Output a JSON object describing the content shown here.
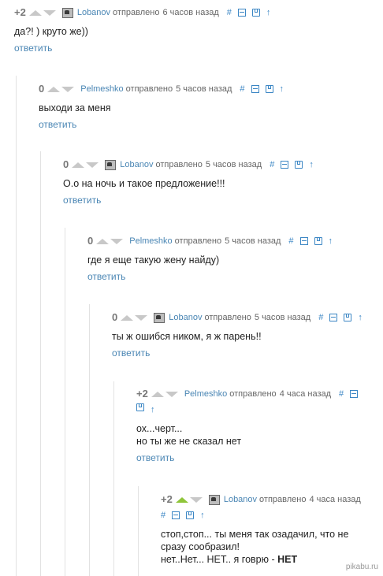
{
  "common": {
    "sent_label": "отправлено",
    "reply_label": "ответить",
    "hash_icon": "#",
    "up_glyph": "↑"
  },
  "comments": [
    {
      "rating": "+2",
      "user": "Lobanov",
      "time": "6 часов назад",
      "lines": [
        "да?! ) круто же))"
      ],
      "upvoted": false,
      "has_avatar": true
    },
    {
      "rating": "0",
      "user": "Pelmeshko",
      "time": "5 часов назад",
      "lines": [
        "выходи за меня"
      ],
      "upvoted": false,
      "has_avatar": false
    },
    {
      "rating": "0",
      "user": "Lobanov",
      "time": "5 часов назад",
      "lines": [
        "О.о на ночь и такое предложение!!!"
      ],
      "upvoted": false,
      "has_avatar": true
    },
    {
      "rating": "0",
      "user": "Pelmeshko",
      "time": "5 часов назад",
      "lines": [
        "где я еще такую жену найду)"
      ],
      "upvoted": false,
      "has_avatar": false
    },
    {
      "rating": "0",
      "user": "Lobanov",
      "time": "5 часов назад",
      "lines": [
        "ты ж ошибся ником, я ж парень!!"
      ],
      "upvoted": false,
      "has_avatar": true
    },
    {
      "rating": "+2",
      "user": "Pelmeshko",
      "time": "4 часа назад",
      "lines": [
        "ох...черт...",
        "но ты же не сказал нет"
      ],
      "upvoted": false,
      "has_avatar": false
    },
    {
      "rating": "+2",
      "user": "Lobanov",
      "time": "4 часа назад",
      "lines": [
        "стоп,стоп... ты меня так озадачил, что не",
        "сразу сообразил!"
      ],
      "last_line_plain": "нет..Нет... НЕТ.. я говрю - ",
      "last_line_bold": "НЕТ",
      "upvoted": true,
      "has_avatar": true
    }
  ],
  "watermark": "pikabu.ru"
}
